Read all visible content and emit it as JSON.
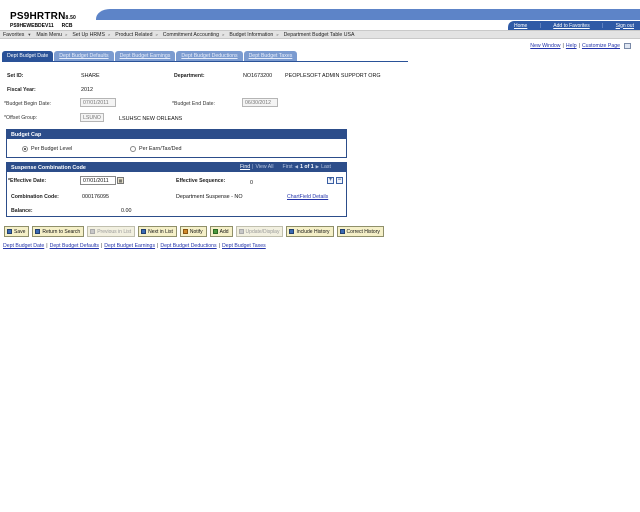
{
  "header": {
    "db_name": "PS9HRTRN",
    "tools_version": "8.50",
    "server": "PS9HEWEBDEV11",
    "user": "RCB",
    "links": [
      "Home",
      "Add to Favorites",
      "Sign out"
    ]
  },
  "menu": [
    "Favorites",
    "Main Menu",
    "Set Up HRMS",
    "Product Related",
    "Commitment Accounting",
    "Budget Information",
    "Department Budget Table USA"
  ],
  "page_links": {
    "new_window": "New Window",
    "help": "Help",
    "customize": "Customize Page"
  },
  "tabs": [
    {
      "label": "Dept Budget Date",
      "active": true
    },
    {
      "label": "Dept Budget Defaults",
      "active": false
    },
    {
      "label": "Dept Budget Earnings",
      "active": false
    },
    {
      "label": "Dept Budget Deductions",
      "active": false
    },
    {
      "label": "Dept Budget Taxes",
      "active": false
    }
  ],
  "form": {
    "setid_label": "Set ID:",
    "setid_value": "SHARE",
    "department_label": "Department:",
    "department_code": "NO1673200",
    "department_desc": "PEOPLESOFT ADMIN SUPPORT ORG",
    "fiscal_year_label": "Fiscal Year:",
    "fiscal_year_value": "2012",
    "begin_date_label": "Budget Begin Date:",
    "begin_date_value": "07/01/2011",
    "end_date_label": "Budget End Date:",
    "end_date_value": "06/30/2012",
    "offset_group_label": "Offset Group:",
    "offset_group_value": "LSUNO",
    "offset_group_desc": "LSUHSC NEW ORLEANS"
  },
  "budget_cap": {
    "title": "Budget Cap",
    "option1": "Per Budget Level",
    "option2": "Per Earn/Tax/Ded",
    "selected": "Per Budget Level"
  },
  "suspense": {
    "title": "Suspense Combination Code",
    "find": "Find",
    "view_all": "View All",
    "first": "First",
    "count": "1 of 1",
    "last": "Last",
    "effective_date_label": "Effective Date:",
    "effective_date_value": "07/01/2011",
    "effective_seq_label": "Effective Sequence:",
    "effective_seq_value": "0",
    "combination_code_label": "Combination Code:",
    "combination_code_value": "000176095",
    "combination_desc": "Department Suspense - NO",
    "chartfield_link": "ChartField Details",
    "balance_label": "Balance:",
    "balance_value": "0.00"
  },
  "toolbar": [
    {
      "label": "Save",
      "enabled": true
    },
    {
      "label": "Return to Search",
      "enabled": true
    },
    {
      "label": "Previous in List",
      "enabled": false
    },
    {
      "label": "Next in List",
      "enabled": true
    },
    {
      "label": "Notify",
      "enabled": true
    },
    {
      "label": "Add",
      "enabled": true
    },
    {
      "label": "Update/Display",
      "enabled": false
    },
    {
      "label": "Include History",
      "enabled": true
    },
    {
      "label": "Correct History",
      "enabled": true
    }
  ],
  "bottom_links": [
    "Dept Budget Date",
    "Dept Budget Defaults",
    "Dept Budget Earnings",
    "Dept Budget Deductions",
    "Dept Budget Taxes"
  ]
}
